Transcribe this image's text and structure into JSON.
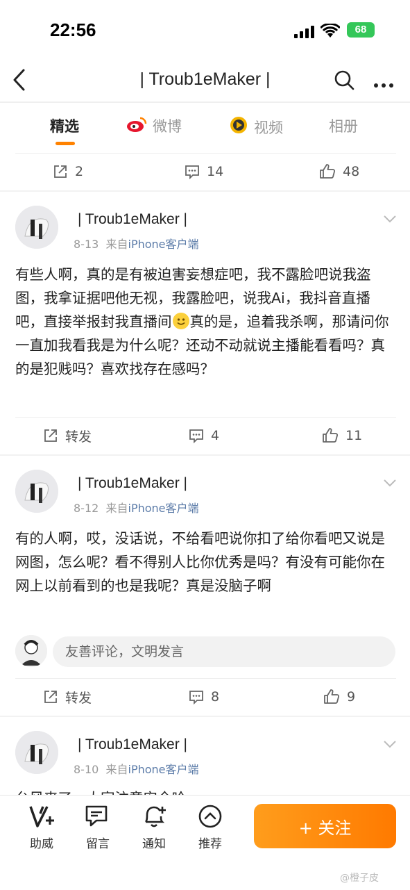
{
  "status_bar": {
    "time": "22:56",
    "battery": "68"
  },
  "nav": {
    "title": "| Troub1eMaker |"
  },
  "tabs": [
    {
      "label": "精选",
      "active": true
    },
    {
      "label": "微博",
      "active": false
    },
    {
      "label": "视频",
      "active": false
    },
    {
      "label": "相册",
      "active": false
    }
  ],
  "top_actions": {
    "repost": "2",
    "comment": "14",
    "like": "48"
  },
  "posts": [
    {
      "author": "| Troub1eMaker |",
      "date": "8-13",
      "source_prefix": "来自",
      "source": "iPhone客户端",
      "text_a": "有些人啊，真的是有被迫害妄想症吧，我不露脸吧说我盗图，我拿证据吧他无视，我露脸吧，说我Ai，我抖音直播吧，直接举报封我直播间",
      "text_b": "真的是，追着我杀啊，那请问你一直加我看我是为什么呢？还动不动就说主播能看看吗？真的是犯贱吗？喜欢找存在感吗？",
      "repost": "转发",
      "comment": "4",
      "like": "11"
    },
    {
      "author": "| Troub1eMaker |",
      "date": "8-12",
      "source_prefix": "来自",
      "source": "iPhone客户端",
      "text": "有的人啊，哎，没话说，不给看吧说你扣了给你看吧又说是网图，怎么呢？看不得别人比你优秀是吗？有没有可能你在网上以前看到的也是我呢？真是没脑子啊",
      "comment_placeholder": "友善评论，文明发言",
      "repost": "转发",
      "comment": "8",
      "like": "9"
    },
    {
      "author": "| Troub1eMaker |",
      "date": "8-10",
      "source_prefix": "来自",
      "source": "iPhone客户端",
      "text": "台风来了，大家注意安全哈"
    }
  ],
  "bottom_bar": {
    "items": [
      "助威",
      "留言",
      "通知",
      "推荐"
    ],
    "follow": "+ 关注",
    "watermark": "@橙子皮"
  },
  "colors": {
    "accent": "#ff8200",
    "link": "#5b7ba8",
    "battery": "#34c759"
  }
}
